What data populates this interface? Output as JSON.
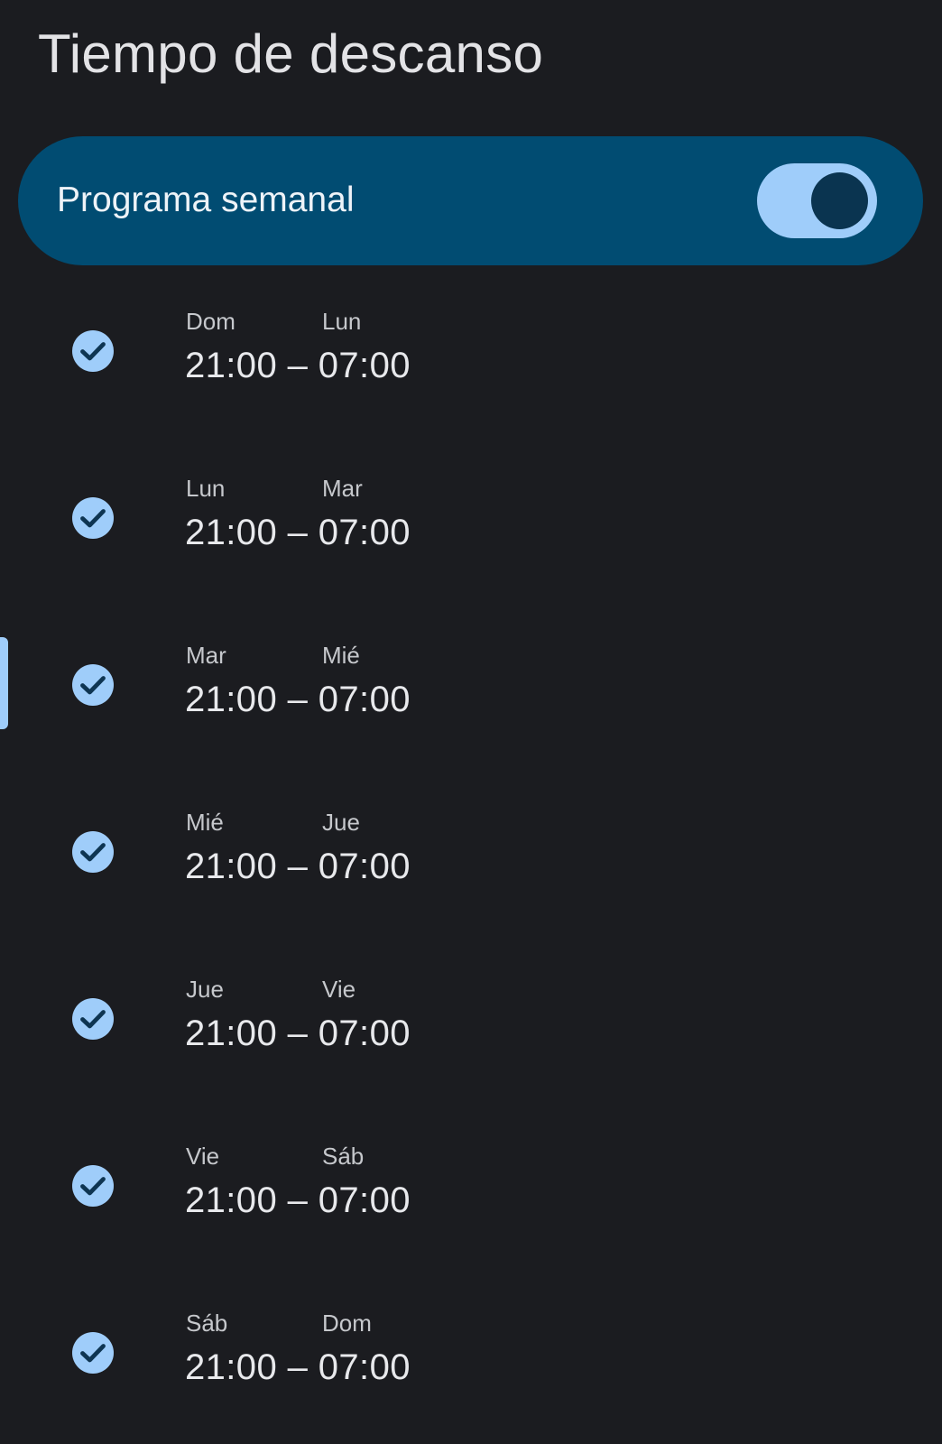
{
  "header": {
    "title": "Tiempo de descanso"
  },
  "weekly_schedule": {
    "label": "Programa semanal",
    "toggle_on": true
  },
  "schedules": [
    {
      "start_day": "Dom",
      "end_day": "Lun",
      "time": "21:00 – 07:00",
      "checked": true
    },
    {
      "start_day": "Lun",
      "end_day": "Mar",
      "time": "21:00 – 07:00",
      "checked": true
    },
    {
      "start_day": "Mar",
      "end_day": "Mié",
      "time": "21:00 – 07:00",
      "checked": true
    },
    {
      "start_day": "Mié",
      "end_day": "Jue",
      "time": "21:00 – 07:00",
      "checked": true
    },
    {
      "start_day": "Jue",
      "end_day": "Vie",
      "time": "21:00 – 07:00",
      "checked": true
    },
    {
      "start_day": "Vie",
      "end_day": "Sáb",
      "time": "21:00 – 07:00",
      "checked": true
    },
    {
      "start_day": "Sáb",
      "end_day": "Dom",
      "time": "21:00 – 07:00",
      "checked": true
    }
  ],
  "icons": {
    "row_icon": "check-circle-icon"
  },
  "colors": {
    "background": "#1b1c20",
    "card": "#014c72",
    "accent": "#9fcdfa"
  }
}
